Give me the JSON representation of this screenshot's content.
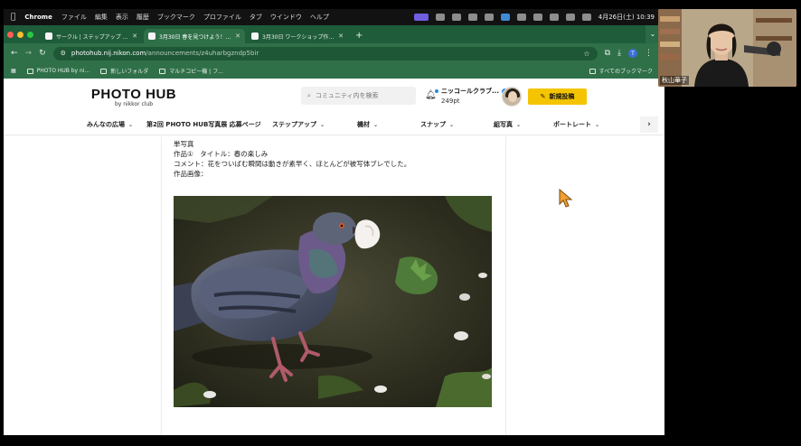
{
  "menubar": {
    "app": "Chrome",
    "items": [
      "ファイル",
      "編集",
      "表示",
      "履歴",
      "ブックマーク",
      "プロファイル",
      "タブ",
      "ウインドウ",
      "ヘルプ"
    ],
    "datetime": "4月26日(土) 10:39"
  },
  "tabs": [
    {
      "title": "サークル | ステップアップ | PH",
      "active": false
    },
    {
      "title": "3月30日 春を見つけよう！ In",
      "active": true
    },
    {
      "title": "3月30日 ワークショップ作品 №",
      "active": false
    }
  ],
  "address": {
    "host": "photohub.nij.nikon.com",
    "path": "/announcements/z4uharbgzndp5bir"
  },
  "bookmarks": {
    "items": [
      "PHOTO HUB by ni...",
      "新しいフォルダ",
      "マルチコピー機 | フ..."
    ],
    "all": "すべてのブックマーク"
  },
  "site": {
    "logo_main": "PHOTO HUB",
    "logo_sub": "by nikkor club",
    "search_placeholder": "コミュニティ内を検索",
    "user_name": "ニッコールクラブ...",
    "user_points": "249pt",
    "post_button": "新規投稿"
  },
  "nav": {
    "items": [
      "みんなの広場",
      "第2回 PHOTO HUB写真展 応募ページ",
      "ステップアップ",
      "機材",
      "スナップ",
      "組写真",
      "ポートレート"
    ]
  },
  "post": {
    "heading": "単写真",
    "title_line": "作品①　タイトル：春の楽しみ",
    "comment_line": "コメント：花をついばむ瞬間は動きが素早く、ほとんどが被写体ブレでした。",
    "image_label": "作品画像："
  },
  "webcam": {
    "name": "秋山華子"
  },
  "colors": {
    "chrome_green": "#2f7048",
    "tab_green": "#1f5c3a",
    "post_button": "#f5c400"
  }
}
